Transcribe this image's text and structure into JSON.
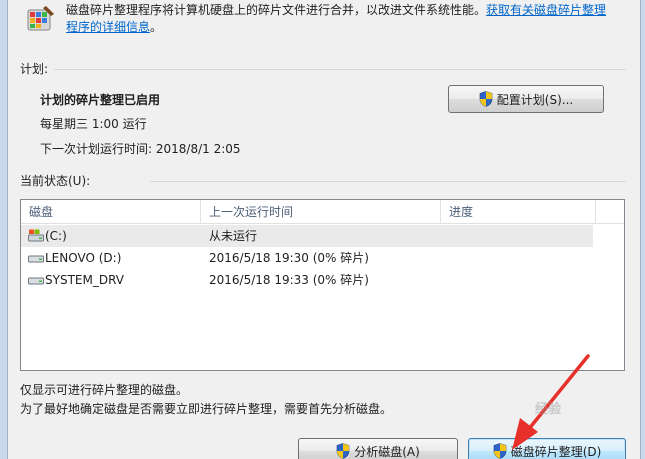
{
  "header": {
    "description": "磁盘碎片整理程序将计算机硬盘上的碎片文件进行合并，以改进文件系统性能。",
    "link_line1": "获取有关磁盘碎片整理",
    "link_line2": "程序的详细信息",
    "trailing": "。"
  },
  "schedule": {
    "section_label": "计划:",
    "status": "计划的碎片整理已启用",
    "frequency": "每星期三  1:00 运行",
    "next_run": "下一次计划运行时间: 2018/8/1 2:05",
    "configure_button": "配置计划(S)..."
  },
  "current_status": {
    "section_label": "当前状态(U):",
    "columns": [
      "磁盘",
      "上一次运行时间",
      "进度"
    ],
    "rows": [
      {
        "disk": "(C:)",
        "last_run": "从未运行",
        "progress": "",
        "icon": "system-drive-icon"
      },
      {
        "disk": "LENOVO (D:)",
        "last_run": "2016/5/18 19:30 (0% 碎片)",
        "progress": "",
        "icon": "hard-drive-icon"
      },
      {
        "disk": "SYSTEM_DRV",
        "last_run": "2016/5/18 19:33 (0% 碎片)",
        "progress": "",
        "icon": "hard-drive-icon"
      }
    ]
  },
  "footer": {
    "note1": "仅显示可进行碎片整理的磁盘。",
    "note2": "为了最好地确定磁盘是否需要立即进行碎片整理，需要首先分析磁盘。",
    "analyze_button": "分析磁盘(A)",
    "defrag_button": "磁盘碎片整理(D)"
  },
  "overlay": {
    "watermark": "经验"
  },
  "colors": {
    "link": "#0066cc",
    "arrow": "#e8302a",
    "primary_button_border": "#3c7fb1"
  }
}
